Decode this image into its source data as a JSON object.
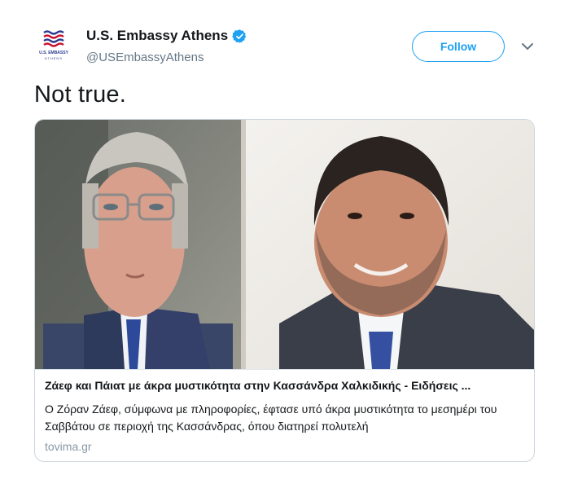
{
  "account": {
    "display_name": "U.S. Embassy Athens",
    "handle": "@USEmbassyAthens",
    "avatar_caption_line1": "U.S. EMBASSY",
    "avatar_caption_line2": "ATHENS",
    "verified": true
  },
  "actions": {
    "follow_label": "Follow",
    "more_icon": "chevron-down-icon"
  },
  "tweet": {
    "text": "Not true."
  },
  "card": {
    "title": "Ζάεφ και Πάιατ με άκρα μυστικότητα στην Κασσάνδρα Χαλκιδικής - Ειδήσεις ...",
    "description": "Ο Ζόραν Ζάεφ, σύμφωνα με πληροφορίες,  έφτασε υπό άκρα μυστικότητα  το μεσημέρι του Σαββάτου σε περιοχή της Κασσάνδρας, όπου διατηρεί πολυτελή",
    "domain": "tovima.gr"
  },
  "colors": {
    "accent": "#1da1f2",
    "text": "#14171a",
    "secondary": "#657786",
    "border": "#ccd6dd"
  }
}
